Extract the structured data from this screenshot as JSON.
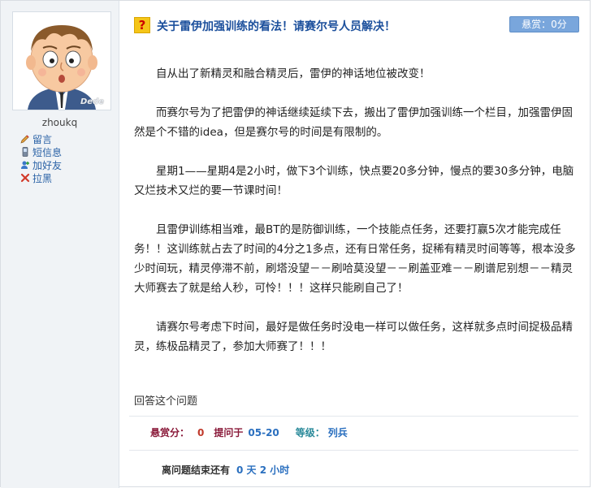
{
  "user": {
    "name": "zhoukq",
    "avatar_watermark": "Dede",
    "actions": [
      {
        "label": "留言",
        "icon": "pencil-icon"
      },
      {
        "label": "短信息",
        "icon": "phone-icon"
      },
      {
        "label": "加好友",
        "icon": "add-friend-icon"
      },
      {
        "label": "拉黑",
        "icon": "block-icon"
      }
    ]
  },
  "question": {
    "icon": "question-mark-icon",
    "icon_text": "?",
    "title": "关于雷伊加强训练的看法！请赛尔号人员解决！",
    "reward_label": "悬赏：0分",
    "paragraphs": [
      "自从出了新精灵和融合精灵后，雷伊的神话地位被改变！",
      "而赛尔号为了把雷伊的神话继续延续下去，搬出了雷伊加强训练一个栏目，加强雷伊固然是个不错的idea，但是赛尔号的时间是有限制的。",
      "星期1——星期4是2小时，做下3个训练，快点要20多分钟，慢点的要30多分钟，电脑又烂技术又烂的要一节课时间！",
      "且雷伊训练相当难，最BT的是防御训练，一个技能点任务，还要打赢5次才能完成任务！！这训练就占去了时间的4分之1多点，还有日常任务，捉稀有精灵时间等等，根本没多少时间玩，精灵停滞不前，刷塔没望－－刷哈莫没望－－刷盖亚难－－刷谱尼别想－－精灵大师赛去了就是给人秒，可怜！！！这样只能刷自己了！",
      "请赛尔号考虑下时间，最好是做任务时没电一样可以做任务，这样就多点时间捉极品精灵，练极品精灵了，参加大师赛了！！！"
    ],
    "answer_link": "回答这个问题",
    "meta": {
      "reward_label": "悬赏分：",
      "reward_value": "0",
      "asked_label": "提问于",
      "asked_date": "05-20",
      "level_label": "等级：",
      "level_value": "列兵"
    },
    "remaining": {
      "label": "离问题结束还有",
      "value": "0 天 2 小时"
    }
  },
  "colors": {
    "title": "#1b4f9c",
    "reward_bg": "#79a6dc",
    "sidebar_bg": "#f0f3f6",
    "link": "#2a62a6"
  }
}
